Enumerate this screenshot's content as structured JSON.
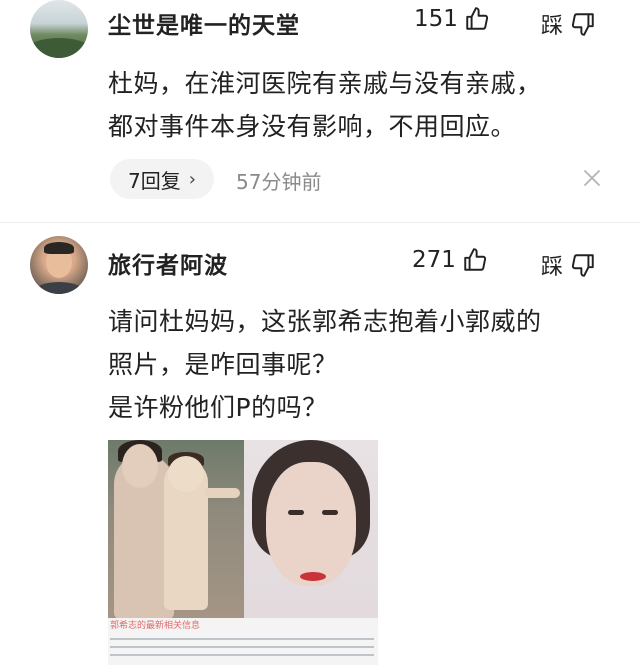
{
  "comments": [
    {
      "username": "尘世是唯一的天堂",
      "likes": "151",
      "dislike_label": "踩",
      "content_lines": [
        "杜妈，在淮河医院有亲戚与没有亲戚，",
        "都对事件本身没有影响，不用回应。"
      ],
      "reply_label": "7回复",
      "timestamp": "57分钟前"
    },
    {
      "username": "旅行者阿波",
      "likes": "271",
      "dislike_label": "踩",
      "content_lines": [
        "请问杜妈妈，这张郭希志抱着小郭威的",
        "照片，是咋回事呢？",
        "是许粉他们P的吗？"
      ],
      "image_caption": "郭希志的最新相关信息"
    }
  ],
  "colors": {
    "text_primary": "#222222",
    "text_secondary": "#8a8a8a",
    "pill_bg": "#f3f3f3",
    "divider": "#ededed"
  },
  "icons": {
    "like": "thumbs-up-icon",
    "dislike": "thumbs-down-icon",
    "close": "close-icon",
    "chevron": "chevron-right-icon"
  }
}
